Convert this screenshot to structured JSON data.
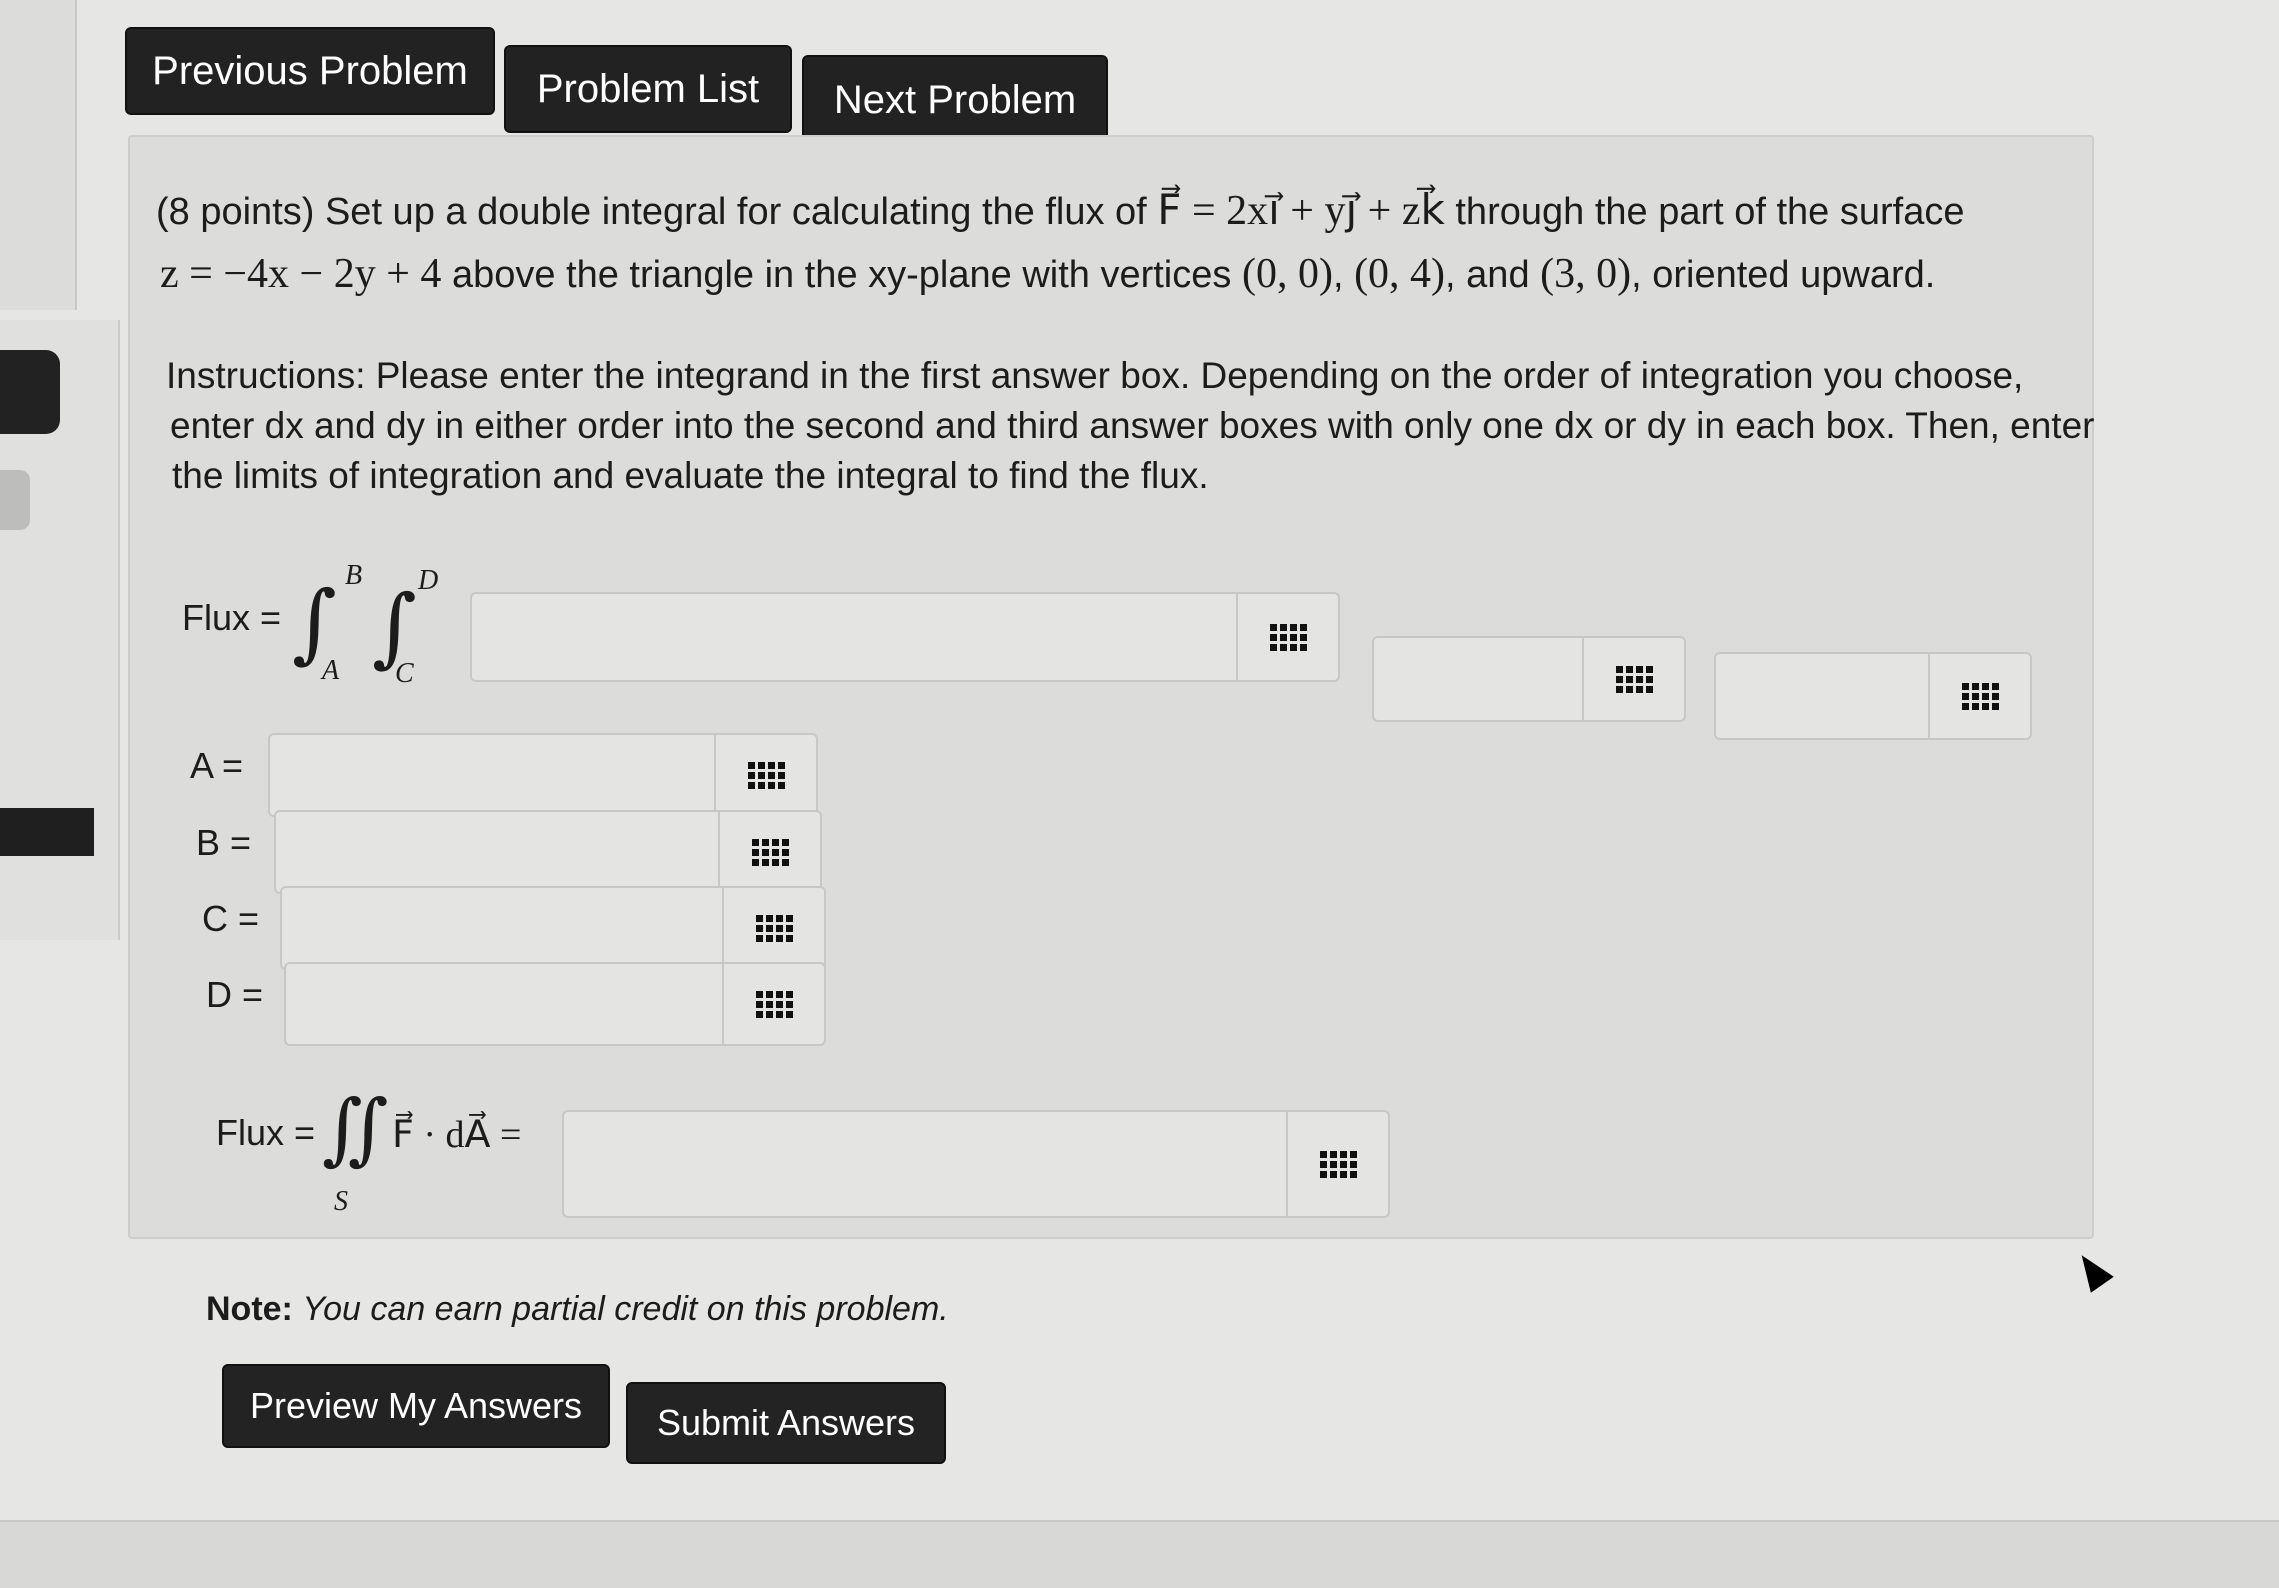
{
  "nav": {
    "prev": "Previous Problem",
    "list": "Problem List",
    "next": "Next Problem"
  },
  "problem": {
    "line1_prefix": "(8 points) Set up a double integral for calculating the flux of",
    "field": "F⃗ = 2xi⃗ + yj⃗ + zk⃗",
    "line1_suffix": "through the part of the surface",
    "surface": "z = −4x − 2y + 4",
    "line2_mid": "above the triangle in the xy-plane with vertices",
    "v1": "(0, 0)",
    "v2": "(0, 4)",
    "and": "and",
    "v3": "(3, 0)",
    "line2_end": ", oriented upward.",
    "instr1": "Instructions: Please enter the integrand in the first answer box. Depending on the order of integration you choose,",
    "instr2": "enter dx and dy in either order into the second and third answer boxes with only one dx or dy in each box. Then, enter",
    "instr3": "the limits of integration and evaluate the integral to find the flux."
  },
  "flux_setup": {
    "label": "Flux =",
    "upper_outer": "B",
    "lower_outer": "A",
    "upper_inner": "D",
    "lower_inner": "C",
    "integrand_value": "",
    "first_diff_value": "",
    "second_diff_value": ""
  },
  "limits": [
    {
      "label": "A =",
      "value": ""
    },
    {
      "label": "B =",
      "value": ""
    },
    {
      "label": "C =",
      "value": ""
    },
    {
      "label": "D =",
      "value": ""
    }
  ],
  "flux_result": {
    "label": "Flux =",
    "expr": "F⃗ · dA⃗ =",
    "region": "S",
    "value": ""
  },
  "note": {
    "bold": "Note:",
    "text": "You can earn partial credit on this problem."
  },
  "actions": {
    "preview": "Preview My Answers",
    "submit": "Submit Answers"
  },
  "icons": {
    "matrix_button": "equation-editor-grid-icon"
  }
}
